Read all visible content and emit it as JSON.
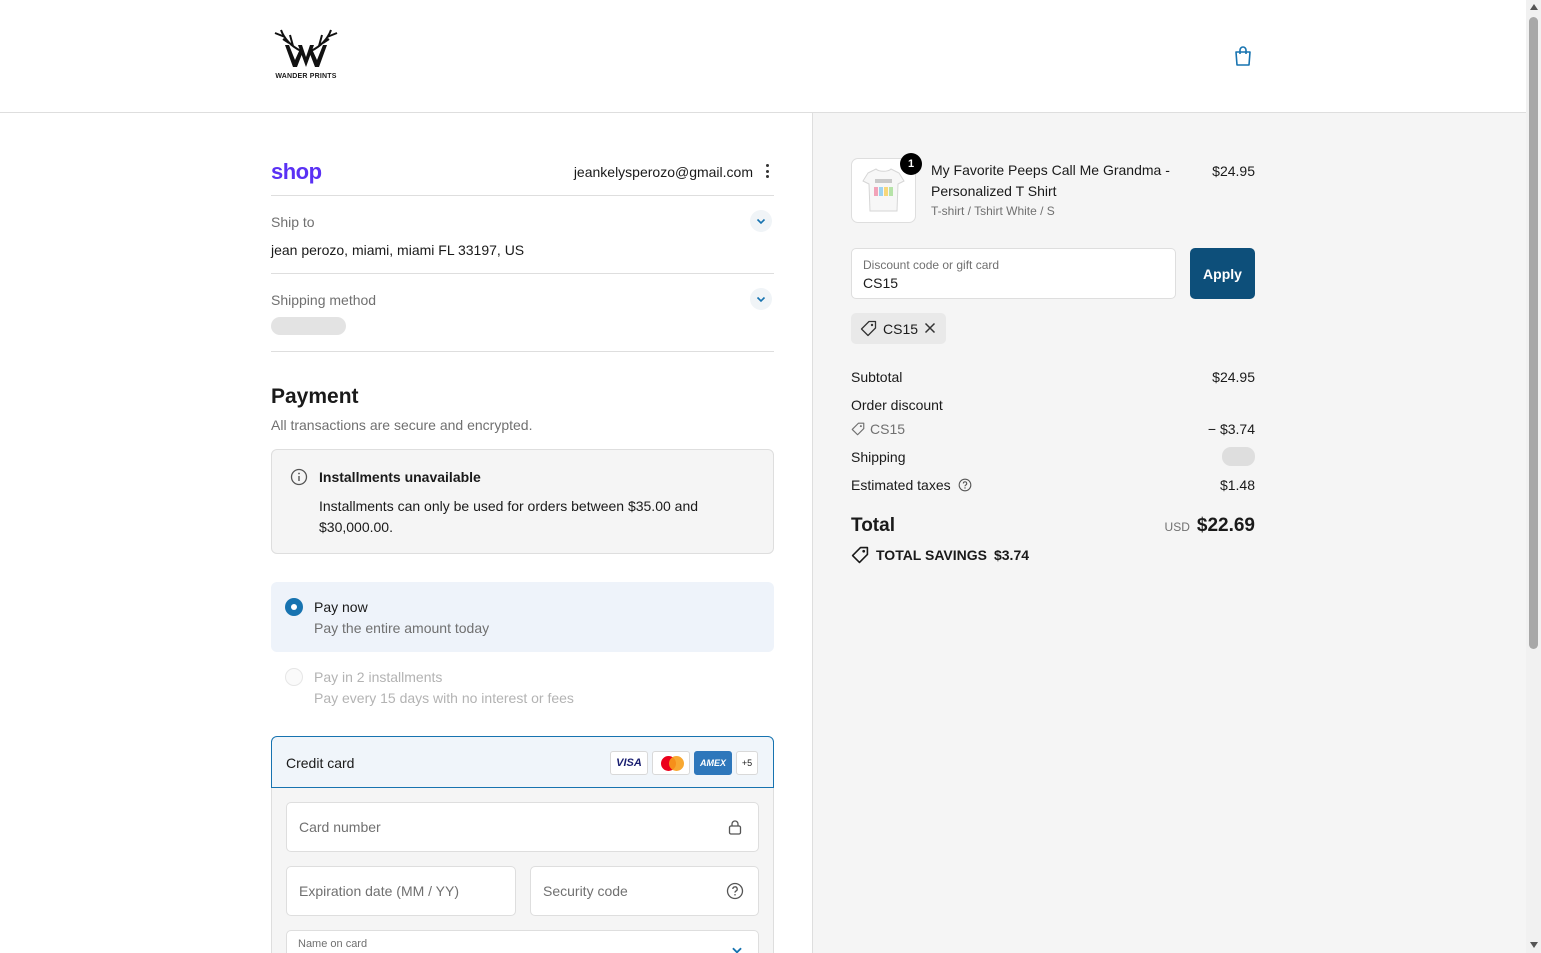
{
  "header": {
    "logo_text": "WANDER PRINTS",
    "cart_icon": "shopping-bag-icon"
  },
  "account": {
    "shop_logo": "shop",
    "email": "jeankelysperozo@gmail.com"
  },
  "ship_to": {
    "label": "Ship to",
    "address": "jean perozo, miami, miami FL 33197, US"
  },
  "shipping_method": {
    "label": "Shipping method"
  },
  "payment": {
    "title": "Payment",
    "subtitle": "All transactions are secure and encrypted.",
    "notice_title": "Installments unavailable",
    "notice_body": "Installments can only be used for orders between $35.00 and $30,000.00.",
    "options": [
      {
        "title": "Pay now",
        "subtitle": "Pay the entire amount today",
        "selected": true
      },
      {
        "title": "Pay in 2 installments",
        "subtitle": "Pay every 15 days with no interest or fees",
        "selected": false
      }
    ],
    "credit_card_label": "Credit card",
    "card_brands": [
      "VISA",
      "AMEX",
      "+5"
    ],
    "card_number_placeholder": "Card number",
    "expiry_placeholder": "Expiration date (MM / YY)",
    "security_placeholder": "Security code",
    "name_label": "Name on card"
  },
  "order": {
    "product_name": "My Favorite Peeps Call Me Grandma - Personalized T Shirt",
    "product_variant": "T-shirt / Tshirt White / S",
    "product_price": "$24.95",
    "quantity": "1",
    "discount_label": "Discount code or gift card",
    "discount_value": "CS15",
    "apply_label": "Apply",
    "applied_code": "CS15",
    "subtotal_label": "Subtotal",
    "subtotal_value": "$24.95",
    "order_discount_label": "Order discount",
    "discount_code": "CS15",
    "discount_amount": "− $3.74",
    "shipping_label": "Shipping",
    "taxes_label": "Estimated taxes",
    "taxes_value": "$1.48",
    "total_label": "Total",
    "currency": "USD",
    "total_value": "$22.69",
    "savings_label": "TOTAL SAVINGS",
    "savings_value": "$3.74"
  },
  "colors": {
    "accent": "#1773b0",
    "apply_button": "#0d4f7a",
    "shop_purple": "#5a31f4"
  }
}
